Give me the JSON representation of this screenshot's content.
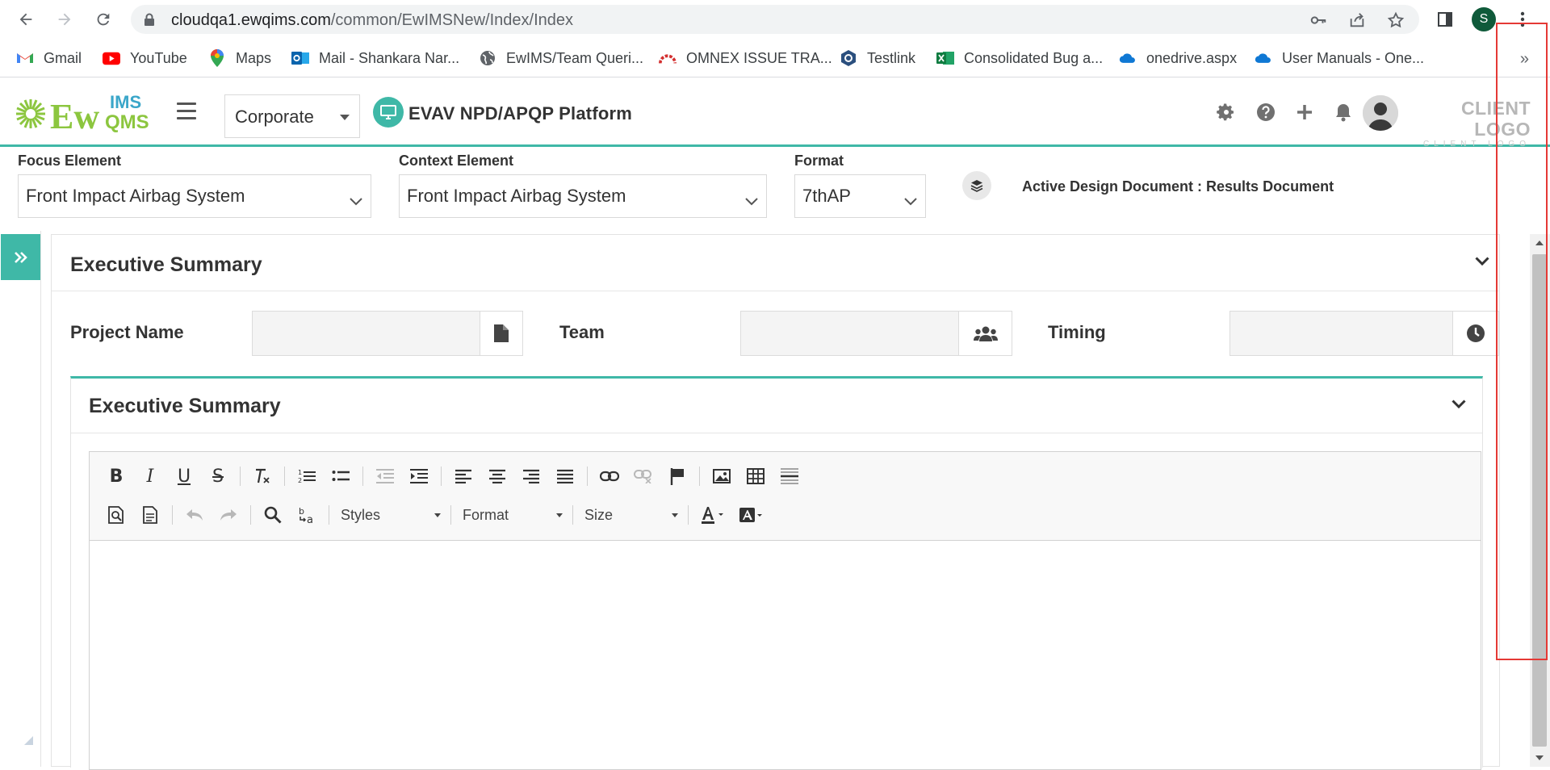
{
  "browser": {
    "url_host": "cloudqa1.ewqims.com",
    "url_path": "/common/EwIMSNew/Index/Index",
    "profile_initial": "S",
    "bookmarks": [
      {
        "label": "Gmail",
        "icon": "gmail-icon"
      },
      {
        "label": "YouTube",
        "icon": "youtube-icon"
      },
      {
        "label": "Maps",
        "icon": "maps-icon"
      },
      {
        "label": "Mail - Shankara Nar...",
        "icon": "outlook-icon"
      },
      {
        "label": "EwIMS/Team Queri...",
        "icon": "globe-icon"
      },
      {
        "label": "OMNEX ISSUE TRA...",
        "icon": "omnex-icon"
      },
      {
        "label": "Testlink",
        "icon": "testlink-icon"
      },
      {
        "label": "Consolidated Bug a...",
        "icon": "excel-icon"
      },
      {
        "label": "onedrive.aspx",
        "icon": "onedrive-icon"
      },
      {
        "label": "User Manuals - One...",
        "icon": "onedrive-icon"
      }
    ],
    "bookmarks_overflow": "»"
  },
  "header": {
    "logo_text": "EwQIMS",
    "org_select": "Corporate",
    "platform_title": "EVAV NPD/APQP Platform",
    "client_logo": "CLIENT LOGO",
    "client_logo_sub": "CLIENT LOGO"
  },
  "filters": {
    "focus_label": "Focus Element",
    "focus_value": "Front Impact Airbag System",
    "context_label": "Context Element",
    "context_value": "Front Impact Airbag System",
    "format_label": "Format",
    "format_value": "7thAP",
    "active_doc": "Active Design Document : Results Document"
  },
  "main": {
    "section_title": "Executive Summary",
    "project_name_label": "Project Name",
    "team_label": "Team",
    "timing_label": "Timing",
    "inner_title": "Executive Summary",
    "toolbar": {
      "styles_label": "Styles",
      "format_label": "Format",
      "size_label": "Size"
    }
  },
  "colors": {
    "accent": "#3fb8a7",
    "highlight": "#e53935"
  }
}
